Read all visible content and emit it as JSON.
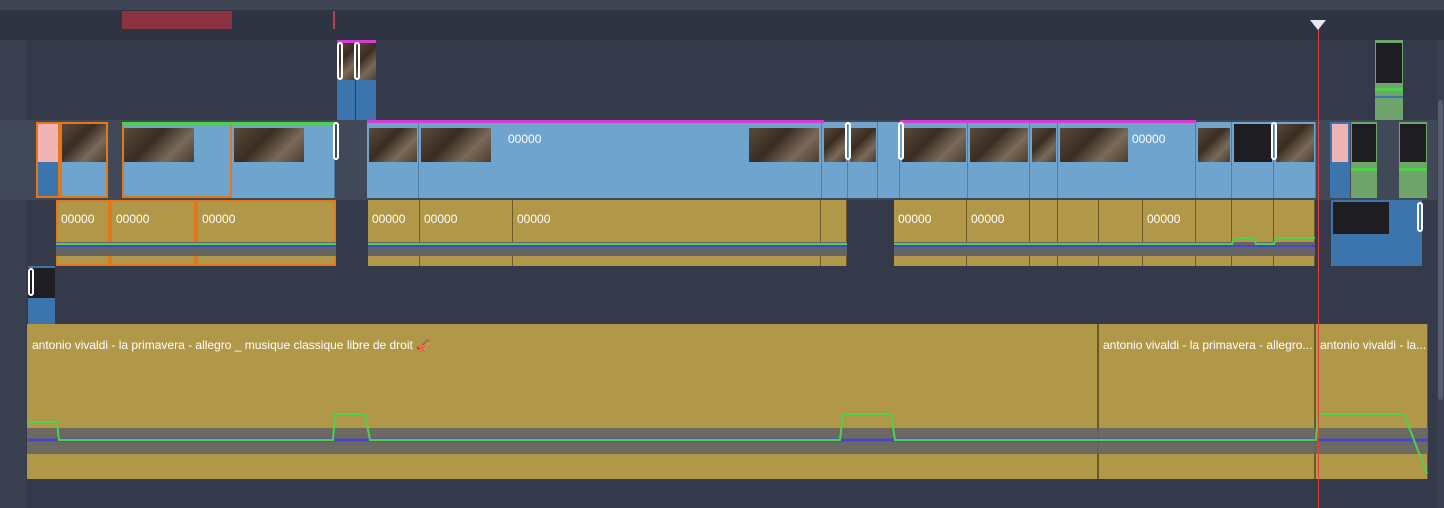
{
  "clips": {
    "video_label": "00000",
    "audio_label": "00000",
    "music_title_full": "antonio vivaldi - la primavera - allegro  _ musique classique libre de droit 🎻",
    "music_title_short": "antonio vivaldi - la primavera - allegro...",
    "music_title_shorter": "antonio vivaldi - la..."
  },
  "colors": {
    "video_clip": "#6fa4cf",
    "audio_clip": "#b09848",
    "playhead": "#e04040",
    "selection_range": "#8b3341",
    "volume_line": "#4fd04f",
    "waveform": "#646464"
  }
}
